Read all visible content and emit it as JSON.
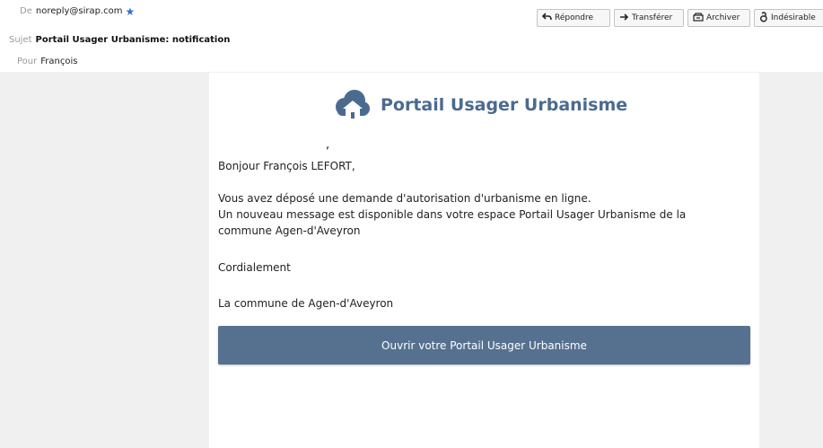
{
  "header": {
    "from_label": "De",
    "from_value": "noreply@sirap.com",
    "subject_label": "Sujet",
    "subject_value": "Portail Usager Urbanisme: notification",
    "to_label": "Pour",
    "to_value": "François",
    "actions": [
      {
        "label": "Répondre",
        "icon": "reply-icon"
      },
      {
        "label": "Transférer",
        "icon": "forward-icon"
      },
      {
        "label": "Archiver",
        "icon": "archive-icon"
      },
      {
        "label": "Indésirable",
        "icon": "junk-icon"
      }
    ]
  },
  "body": {
    "brand_title": "Portail Usager Urbanisme",
    "tick": ",",
    "greeting": "Bonjour François LEFORT,",
    "line1": "Vous avez déposé une demande d'autorisation d'urbanisme en ligne.",
    "line2": "Un nouveau message est disponible dans votre espace Portail Usager Urbanisme de la",
    "line3": "commune Agen-d'Aveyron",
    "regards": "Cordialement",
    "signature": "La commune de Agen-d'Aveyron",
    "cta_label": "Ouvrir votre Portail Usager Urbanisme"
  },
  "colors": {
    "brand": "#4a6b8f",
    "button": "#56708f",
    "star": "#2c6fe0"
  }
}
